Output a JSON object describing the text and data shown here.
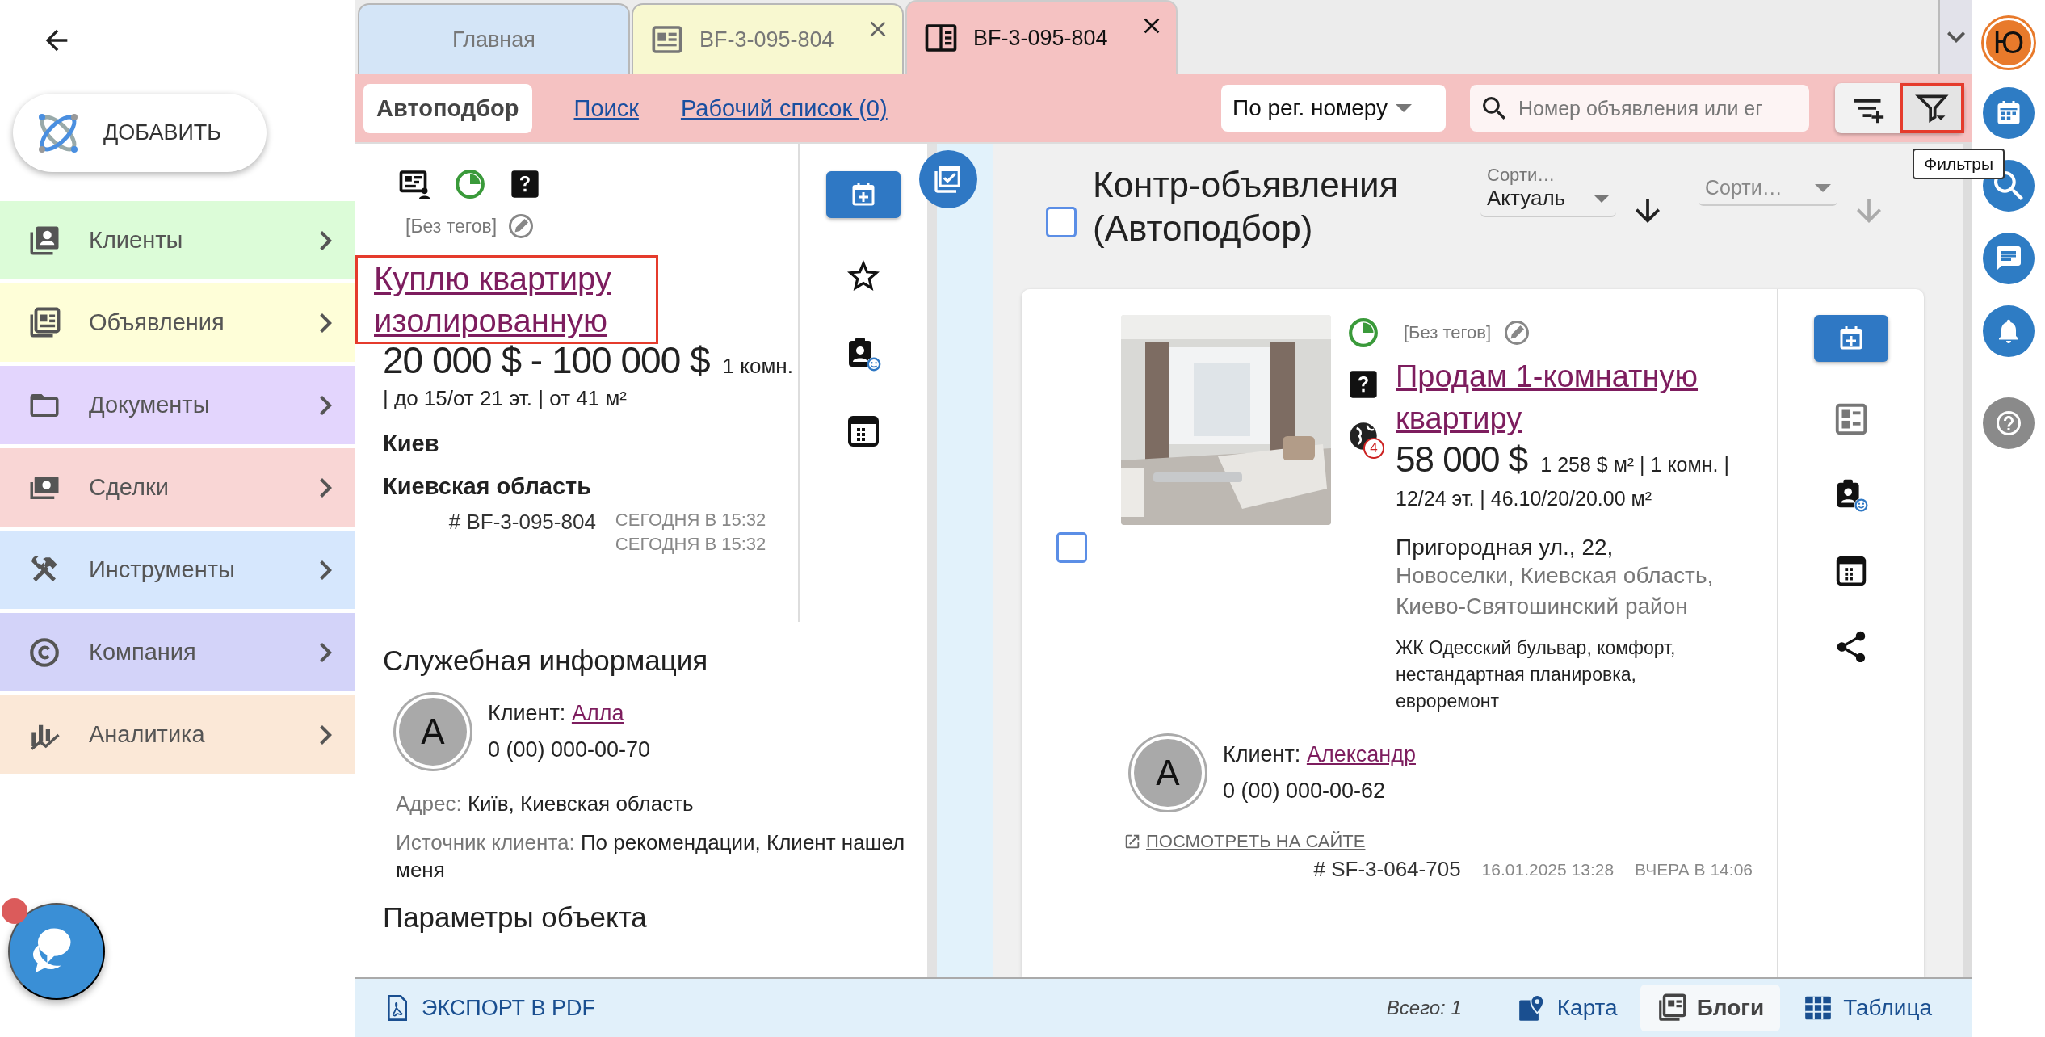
{
  "sidebar": {
    "add_button": "ДОБАВИТЬ",
    "items": [
      {
        "label": "Клиенты",
        "kind": "clients",
        "color": "#dcfcd8"
      },
      {
        "label": "Объявления",
        "kind": "listings",
        "color": "#fefed8"
      },
      {
        "label": "Документы",
        "kind": "documents",
        "color": "#e3d5fd"
      },
      {
        "label": "Сделки",
        "kind": "deals",
        "color": "#f9d6d5"
      },
      {
        "label": "Инструменты",
        "kind": "tools",
        "color": "#d6e7fd"
      },
      {
        "label": "Компания",
        "kind": "company",
        "color": "#d3d3f9"
      },
      {
        "label": "Аналитика",
        "kind": "analytics",
        "color": "#fbe8d7"
      }
    ],
    "chat_unread": true
  },
  "tabs": [
    {
      "label": "Главная",
      "kind": "home",
      "color": "#d4e5f7",
      "closable": false,
      "selected": false
    },
    {
      "label": "BF-3-095-804",
      "kind": "listing",
      "color": "#f8f8d0",
      "closable": true,
      "selected": false
    },
    {
      "label": "BF-3-095-804",
      "kind": "listing-open",
      "color": "#f5c2c2",
      "closable": true,
      "selected": true
    }
  ],
  "toolbar": {
    "subtabs": [
      {
        "label": "Автоподбор",
        "selected": true
      },
      {
        "label": "Поиск",
        "selected": false
      },
      {
        "label": "Рабочий список (0)",
        "selected": false
      }
    ],
    "search_mode": "По рег. номеру",
    "search": {
      "placeholder": "Номер объявления или ег"
    },
    "filter_highlighted": true,
    "filter_tooltip": "Фильтры"
  },
  "listing": {
    "tags": "[Без тегов]",
    "title": "Куплю квартиру изолированную",
    "title_highlighted": true,
    "price": "20 000 $ - 100 000 $",
    "details": "1 комн. | до 15/от 21 эт. | от 41 м²",
    "city": "Киев",
    "region": "Киевская область",
    "number": "# BF-3-095-804",
    "dates": [
      "СЕГОДНЯ В 15:32",
      "СЕГОДНЯ В 15:32"
    ]
  },
  "service_info": {
    "heading": "Служебная информация",
    "client": {
      "initial": "А",
      "label": "Клиент:",
      "name": "Алла",
      "phone": "0 (00) 000-00-70"
    },
    "fields": [
      {
        "label": "Адрес:",
        "value": "Київ, Киевская область"
      },
      {
        "label": "Источник клиента:",
        "value": "По рекомендации, Клиент нашел меня"
      }
    ]
  },
  "params_heading": "Параметры объекта",
  "matches": {
    "title": "Контр-объявления (Автоподбор)",
    "all_checked": false,
    "sorts": [
      {
        "label": "Сорти…",
        "value": "Актуаль",
        "disabled": false
      },
      {
        "label": "Сорти…",
        "disabled": true
      }
    ],
    "cards": [
      {
        "checked": false,
        "tags": "[Без тегов]",
        "title": "Продам 1-комнатную квартиру",
        "site_count": "4",
        "price": "58 000 $",
        "details": "1 258 $ м² | 1 комн. | 12/24 эт. | 46.10/20/20.00 м²",
        "street": "Пригородная ул., 22,",
        "locality": "Новоселки, Киевская область, Киево-Святошинский район",
        "description": "ЖК Одесский бульвар, комфорт, нестандартная планировка, евроремонт",
        "client": {
          "initial": "А",
          "label": "Клиент:",
          "name": "Александр",
          "phone": "0 (00) 000-00-62"
        },
        "site_link": "ПОСМОТРЕТЬ НА САЙТЕ",
        "number": "# SF-3-064-705",
        "created": "16.01.2025 13:28",
        "updated": "ВЧЕРА В 14:06"
      }
    ]
  },
  "footer": {
    "export": "ЭКСПОРТ В PDF",
    "total": "Всего: 1",
    "views": [
      {
        "label": "Карта",
        "kind": "map",
        "selected": false
      },
      {
        "label": "Блоги",
        "kind": "blocks",
        "selected": true
      },
      {
        "label": "Таблица",
        "kind": "table",
        "selected": false
      }
    ]
  },
  "rail": {
    "avatar": "Ю",
    "buttons": [
      {
        "kind": "calendar"
      },
      {
        "kind": "search"
      },
      {
        "kind": "chat"
      },
      {
        "kind": "bell"
      },
      {
        "kind": "help"
      }
    ]
  }
}
